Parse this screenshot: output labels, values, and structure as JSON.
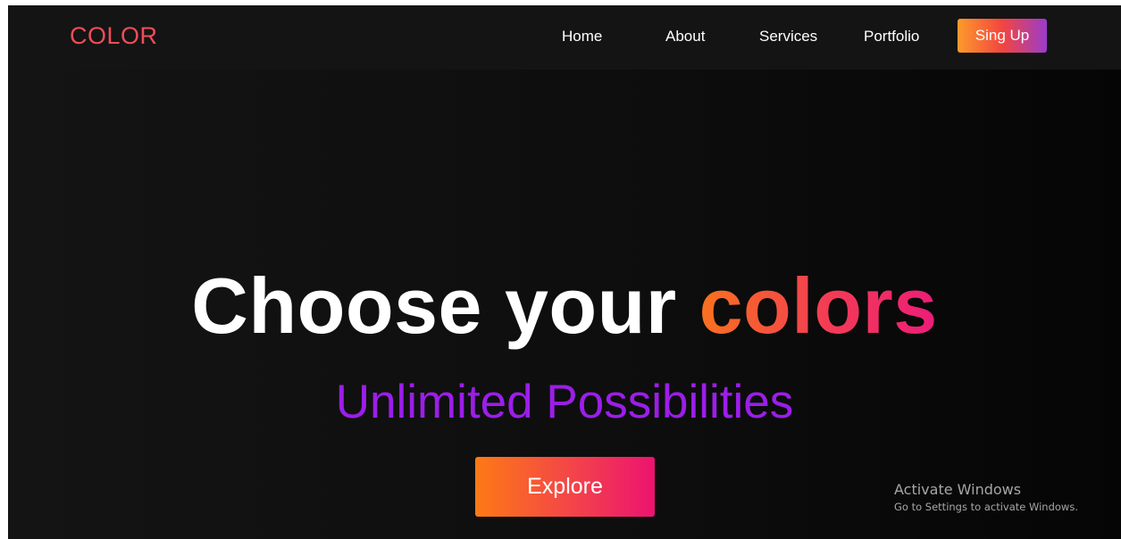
{
  "header": {
    "logo": "COLOR",
    "nav": {
      "home": "Home",
      "about": "About",
      "services": "Services",
      "portfolio": "Portfolio"
    },
    "signup_label": "Sing Up"
  },
  "hero": {
    "title_plain": "Choose your ",
    "title_highlight": "colors",
    "subtitle": "Unlimited Possibilities",
    "explore_label": "Explore"
  },
  "watermark": {
    "title": "Activate Windows",
    "subtitle": "Go to Settings to activate Windows."
  },
  "colors": {
    "logo": "#ef4d58",
    "subtitle": "#9b1ee9",
    "accent_orange": "#f8721e",
    "accent_pink": "#ec1c79",
    "signup_purple": "#9a3ccc",
    "background": "#0d0d0d"
  }
}
